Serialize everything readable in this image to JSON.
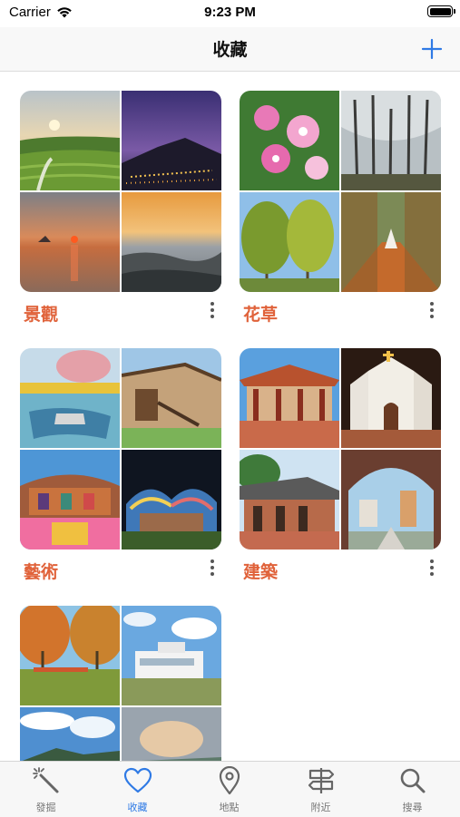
{
  "status": {
    "carrier": "Carrier",
    "time": "9:23 PM"
  },
  "nav": {
    "title": "收藏"
  },
  "albums": [
    {
      "name": "景觀"
    },
    {
      "name": "花草"
    },
    {
      "name": "藝術"
    },
    {
      "name": "建築"
    },
    {
      "name": ""
    }
  ],
  "tabs": [
    {
      "label": "發掘",
      "icon": "magic-wand-icon"
    },
    {
      "label": "收藏",
      "icon": "heart-icon"
    },
    {
      "label": "地點",
      "icon": "location-pin-icon"
    },
    {
      "label": "附近",
      "icon": "signpost-icon"
    },
    {
      "label": "搜尋",
      "icon": "search-icon"
    }
  ],
  "colors": {
    "accent": "#2f7ae5",
    "album_title": "#e0623a"
  }
}
